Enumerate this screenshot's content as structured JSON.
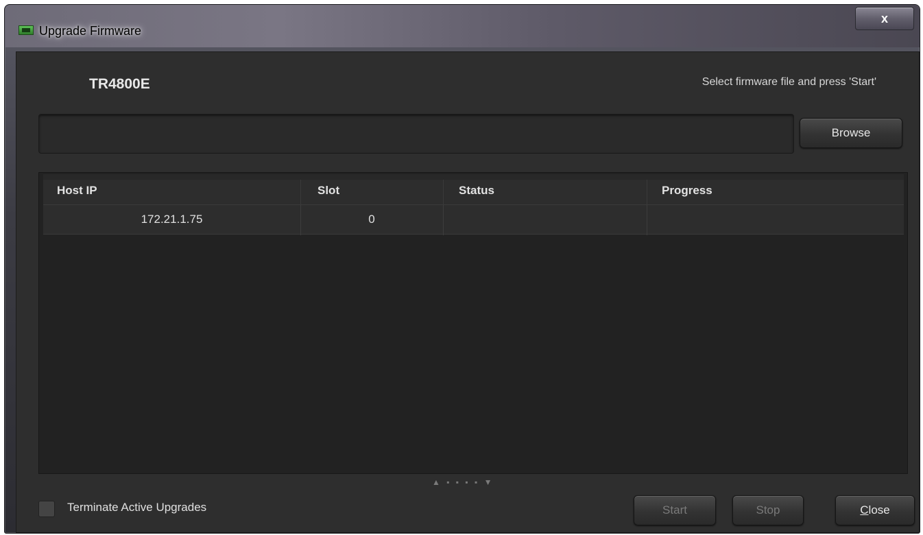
{
  "window": {
    "title": "Upgrade Firmware",
    "close_glyph": "x"
  },
  "header": {
    "device_name": "TR4800E",
    "hint": "Select firmware file and press 'Start'"
  },
  "file_input": {
    "value": "",
    "browse_label": "Browse"
  },
  "table": {
    "columns": [
      "Host IP",
      "Slot",
      "Status",
      "Progress"
    ],
    "rows": [
      {
        "host_ip": "172.21.1.75",
        "slot": "0",
        "status": "",
        "progress": ""
      }
    ]
  },
  "splitter": "▲ ▪ ▪ ▪ ▪ ▼",
  "footer": {
    "terminate_label": "Terminate Active Upgrades",
    "terminate_checked": false,
    "start_label": "Start",
    "stop_label": "Stop",
    "close_label_mnemonic": "C",
    "close_label_rest": "lose"
  }
}
